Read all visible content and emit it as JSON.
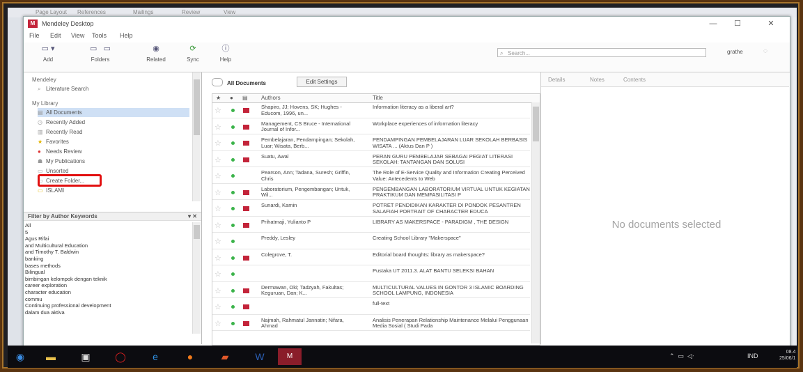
{
  "background_ribbon": [
    "Page Layout",
    "References",
    "Mailings",
    "Review",
    "View"
  ],
  "window": {
    "app_logo": "M",
    "title": "Mendeley Desktop",
    "controls": {
      "minimize": "—",
      "maximize": "☐",
      "close": "✕"
    }
  },
  "menu": [
    "File",
    "Edit",
    "View",
    "Tools",
    "Help"
  ],
  "toolbar": {
    "add": {
      "icon": "add-document-icon",
      "label": "Add"
    },
    "folders": {
      "icon": "folder-icon",
      "label": "Folders"
    },
    "related": {
      "icon": "eye-icon",
      "label": "Related"
    },
    "sync": {
      "icon": "sync-icon",
      "label": "Sync"
    },
    "help": {
      "icon": "help-icon",
      "label": "Help"
    },
    "search_placeholder": "Search...",
    "user": "grathe"
  },
  "library": {
    "mendeley_header": "Mendeley",
    "literature_search": "Literature Search",
    "my_library_header": "My Library",
    "items": [
      {
        "label": "All Documents",
        "selected": true
      },
      {
        "label": "Recently Added"
      },
      {
        "label": "Recently Read"
      },
      {
        "label": "Favorites"
      },
      {
        "label": "Needs Review"
      },
      {
        "label": "My Publications"
      },
      {
        "label": "Unsorted"
      },
      {
        "label": "Create Folder..."
      },
      {
        "label": "ISLAMI"
      }
    ]
  },
  "filter": {
    "header": "Filter by Author Keywords",
    "items": [
      "All",
      "5",
      "Agus Rifai",
      "and Multicultural Education",
      "and Timothy T. Baldwin",
      "banking",
      "bases methods",
      "Bilingual",
      "bimbingan kelompok dengan teknik",
      "career exploration",
      "character education",
      "commu",
      "Continuing professional development",
      "dalam dua aktiva"
    ]
  },
  "center": {
    "breadcrumb": "All Documents",
    "edit_settings": "Edit Settings",
    "columns": {
      "star": "★",
      "read": "●",
      "file": "▤",
      "authors": "Authors",
      "title": "Title"
    },
    "rows": [
      {
        "authors": "Shapiro, JJ; Hovens, SK; Hughes - Educom, 1996, un...",
        "title": "Information literacy as a liberal art?",
        "pdf": true
      },
      {
        "authors": "Management, CS Bruce - International Journal of Infor...",
        "title": "Workplace experiences of information literacy",
        "pdf": true
      },
      {
        "authors": "Pembelajaran, Pendampingan; Sekolah, Luar; Wisata, Berb...",
        "title": "PENDAMPINGAN PEMBELAJARAN LUAR SEKOLAH BERBASIS WISATA ... (Aktus Dan P )",
        "pdf": true
      },
      {
        "authors": "Suatu, Awal",
        "title": "PERAN GURU PEMBELAJAR SEBAGAI PEGIAT LITERASI SEKOLAH: TANTANGAN DAN SOLUSI",
        "pdf": true
      },
      {
        "authors": "Pearson, Ann; Tadana, Suresh; Griffin, Chris",
        "title": "The Role of E-Service Quality and Information Creating Perceived Value: Antecedents to Web",
        "pdf": false
      },
      {
        "authors": "Laboratorium, Pengembangan; Untuk, Wil...",
        "title": "PENGEMBANGAN LABORATORIUM VIRTUAL UNTUK KEGIATAN PRAKTIKUM DAN MEMFASILITASI P",
        "pdf": true
      },
      {
        "authors": "Sunardi, Kamin",
        "title": "POTRET PENDIDIKAN KARAKTER DI PONDOK PESANTREN SALAFIAH PORTRAIT OF CHARACTER EDUCA",
        "pdf": true
      },
      {
        "authors": "Prihatmaji, Yulianto P",
        "title": "LIBRARY AS MAKERSPACE - PARADIGM , THE DESIGN",
        "pdf": true
      },
      {
        "authors": "Preddy, Lesley",
        "title": "Creating School Library \"Makerspace\"",
        "pdf": false
      },
      {
        "authors": "Colegrove, T.",
        "title": "Editorial board thoughts: library as makerspace?",
        "pdf": true
      },
      {
        "authors": "",
        "title": "Pustaka UT 2011.3. ALAT BANTU SELEKSI BAHAN",
        "pdf": false
      },
      {
        "authors": "Dermawan, Oki; Tadzyah, Fakultas; Keguruan, Dan; K...",
        "title": "MULTICULTURAL VALUES IN GONTOR 3 ISLAMIC BOARDING SCHOOL LAMPUNG, INDONESIA",
        "pdf": true
      },
      {
        "authors": "",
        "title": "full-text",
        "pdf": true
      },
      {
        "authors": "Najmah, Rahmatul Jannatin; Nifara, Ahmad",
        "title": "Analisis Penerapan Relationship Maintenance Melalui Penggunaan Media Sosial ( Studi Pada",
        "pdf": true
      }
    ]
  },
  "details": {
    "tabs": [
      "Details",
      "Notes",
      "Contents"
    ],
    "empty_message": "No documents selected"
  },
  "taskbar": {
    "apps": [
      "windows-start-icon",
      "file-explorer-icon",
      "store-icon",
      "opera-icon",
      "edge-icon",
      "firefox-icon",
      "powerpoint-icon",
      "word-icon",
      "mendeley-icon"
    ],
    "tray": {
      "language": "IND",
      "time": "08.4",
      "date": "25/06/1"
    }
  }
}
